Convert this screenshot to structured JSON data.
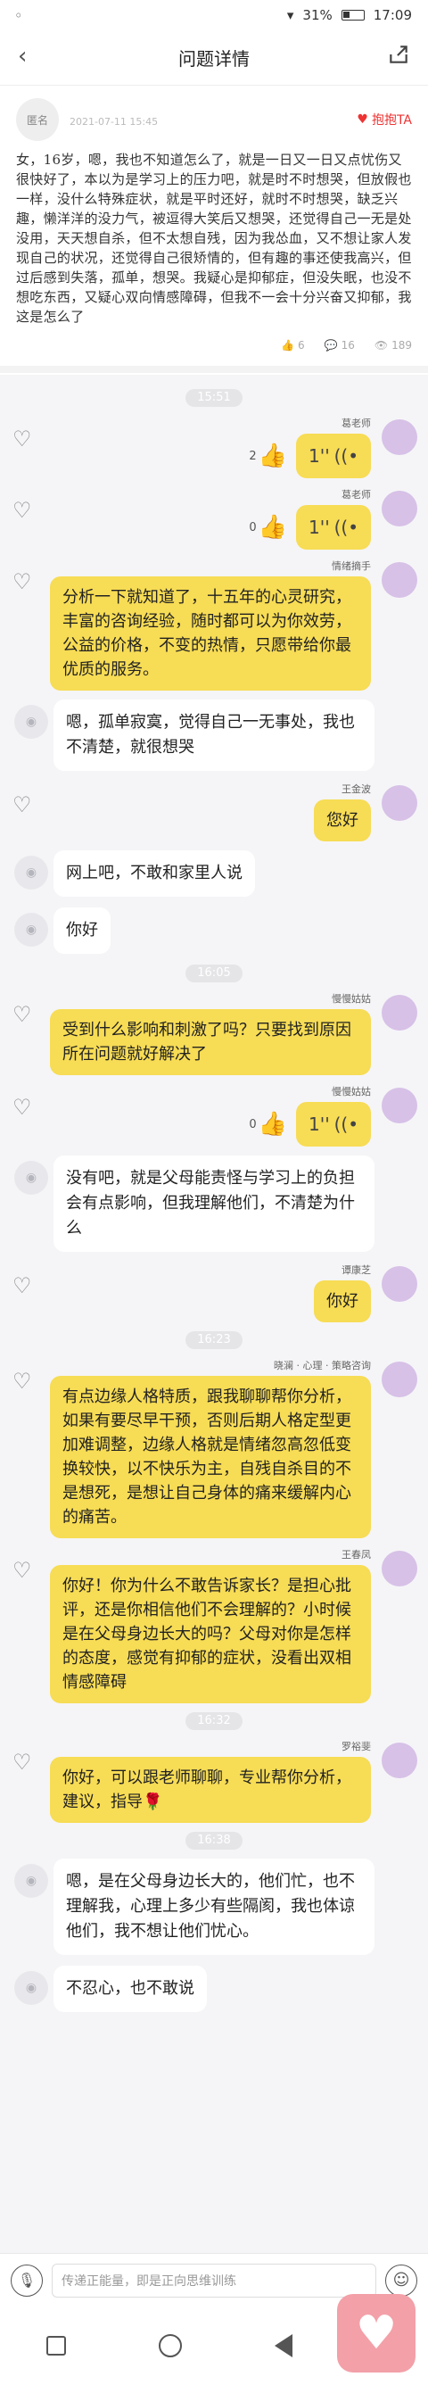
{
  "status": {
    "time": "17:09",
    "battery": "31%"
  },
  "header": {
    "title": "问题详情",
    "back": "‹",
    "share": "↗"
  },
  "question": {
    "avatar_label": "匿名",
    "user": "匿名",
    "name": "",
    "date": "2021-07-11 15:45",
    "hug_label": "抱抱TA",
    "text": "女，16岁，嗯，我也不知道怎么了，就是一日又一日又点忧伤又很快好了，本以为是学习上的压力吧，就是时不时想哭，但放假也一样，没什么特殊症状，就是平时还好，就时不时想哭，缺乏兴趣，懒洋洋的没力气，被逗得大笑后又想哭，还觉得自己一无是处没用，天天想自杀，但不太想自残，因为我怂血，又不想让家人发现自己的状况，还觉得自己很矫情的，但有趣的事还使我高兴，但过后感到失落，孤单，想哭。我疑心是抑郁症，但没失眠，也没不想吃东西，又疑心双向情感障碍，但我不一会十分兴奋又抑郁，我这是怎么了",
    "likes": "6",
    "comments": "16",
    "views": "189"
  },
  "messages": [
    {
      "time": "15:51"
    },
    {
      "side": "right",
      "type": "voice",
      "name": "葛老师",
      "likes": "2",
      "voice": "1''"
    },
    {
      "side": "right",
      "type": "voice",
      "name": "葛老师",
      "likes": "0",
      "voice": "1''"
    },
    {
      "side": "right",
      "type": "text",
      "name": "情绪摘手",
      "text": "分析一下就知道了，十五年的心灵研究，丰富的咨询经验，随时都可以为你效劳，公益的价格，不变的热情，只愿带给你最优质的服务。"
    },
    {
      "side": "left",
      "type": "text",
      "text": "嗯，孤单寂寞，觉得自己一无事处，我也不清楚，就很想哭"
    },
    {
      "side": "right",
      "type": "text",
      "name": "王金波",
      "text": "您好"
    },
    {
      "side": "left",
      "type": "text",
      "text": "网上吧，不敢和家里人说"
    },
    {
      "side": "left",
      "type": "text",
      "text": "你好"
    },
    {
      "time": "16:05"
    },
    {
      "side": "right",
      "type": "text",
      "name": "慢慢姑姑",
      "text": "受到什么影响和刺激了吗？只要找到原因所在问题就好解决了"
    },
    {
      "side": "right",
      "type": "voice",
      "name": "慢慢姑姑",
      "likes": "0",
      "voice": "1''"
    },
    {
      "side": "left",
      "type": "text",
      "text": "没有吧，就是父母能责怪与学习上的负担会有点影响，但我理解他们，不清楚为什么"
    },
    {
      "side": "right",
      "type": "text",
      "name": "谭康芝",
      "text": "你好"
    },
    {
      "time": "16:23"
    },
    {
      "side": "right",
      "type": "text",
      "name": "晓澜 · 心理 · 策略咨询",
      "text": "有点边缘人格特质，跟我聊聊帮你分析，如果有要尽早干预，否则后期人格定型更加难调整，边缘人格就是情绪忽高忽低变换较快，以不快乐为主，自残自杀目的不是想死，是想让自己身体的痛来缓解内心的痛苦。"
    },
    {
      "side": "right",
      "type": "text",
      "name": "王春凤",
      "text": "你好！你为什么不敢告诉家长？是担心批评，还是你相信他们不会理解的？小时候是在父母身边长大的吗？父母对你是怎样的态度，感觉有抑郁的症状，没看出双相情感障碍"
    },
    {
      "time": "16:32"
    },
    {
      "side": "right",
      "type": "text",
      "name": "罗裕斐",
      "text": "你好，可以跟老师聊聊，专业帮你分析，建议，指导🌹"
    },
    {
      "time": "16:38"
    },
    {
      "side": "left",
      "type": "text",
      "text": "嗯，是在父母身边长大的，他们忙，也不理解我，心理上多少有些隔阂，我也体谅他们，我不想让他们忧心。"
    },
    {
      "side": "left",
      "type": "text",
      "text": "不忍心，也不敢说"
    }
  ],
  "input": {
    "placeholder": "传递正能量，即是正向思维训练"
  }
}
